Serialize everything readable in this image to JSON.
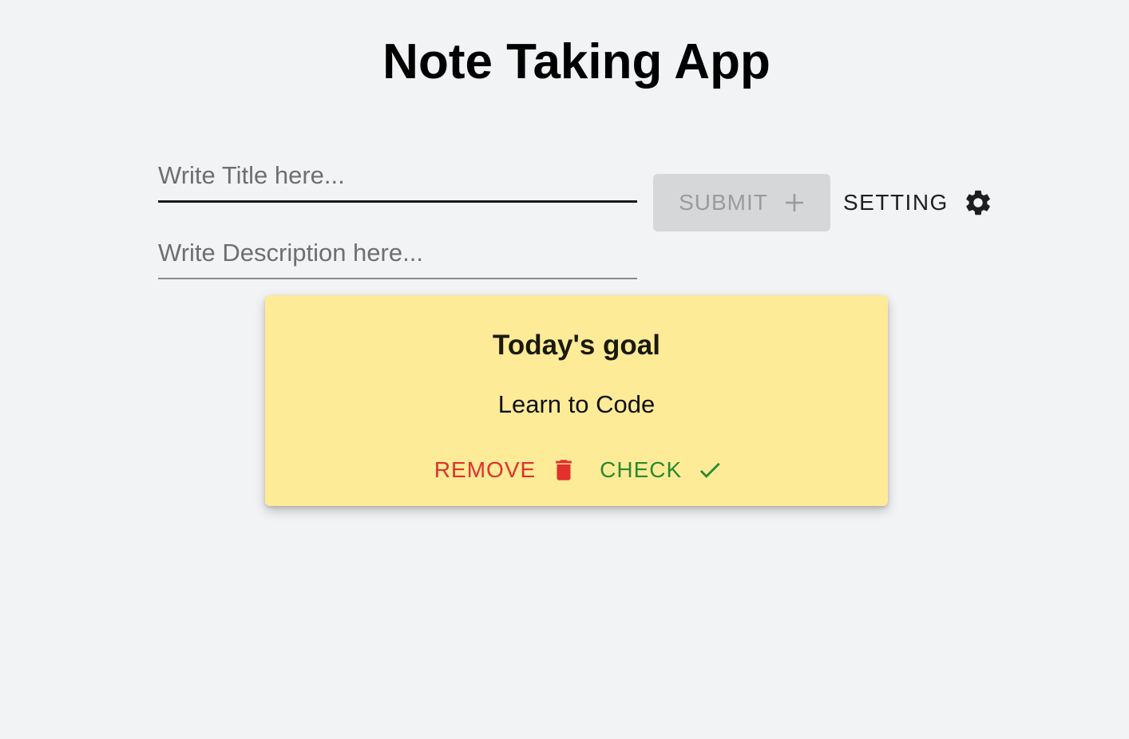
{
  "app": {
    "title": "Note Taking App"
  },
  "form": {
    "title_placeholder": "Write Title here...",
    "title_value": "",
    "description_placeholder": "Write Description here...",
    "description_value": "",
    "submit_label": "SUBMIT",
    "submit_icon": "plus-icon",
    "setting_label": "SETTING",
    "setting_icon": "gear-icon"
  },
  "notes": [
    {
      "title": "Today's goal",
      "description": "Learn to Code",
      "remove_label": "REMOVE",
      "remove_icon": "trash-icon",
      "check_label": "CHECK",
      "check_icon": "check-icon"
    }
  ],
  "colors": {
    "background": "#f2f3f5",
    "note_background": "#feeb98",
    "remove": "#e0312d",
    "check": "#2a8a2e",
    "submit_disabled_bg": "#d6d7d9",
    "submit_disabled_text": "#9a9b9d"
  }
}
